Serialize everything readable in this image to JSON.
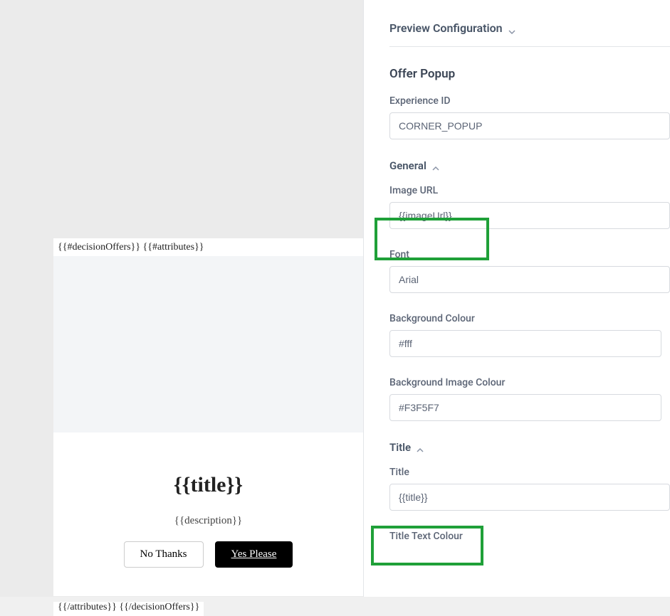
{
  "preview": {
    "header_template": "{{#decisionOffers}} {{#attributes}}",
    "footer_template": "{{/attributes}} {{/decisionOffers}}",
    "title_placeholder": "{{title}}",
    "description_placeholder": "{{description}}",
    "btn_no": "No Thanks",
    "btn_yes": "Yes Please"
  },
  "config": {
    "preview_config_label": "Preview Configuration",
    "offer_popup_title": "Offer Popup",
    "experience_id": {
      "label": "Experience ID",
      "value": "CORNER_POPUP"
    },
    "general": {
      "section_label": "General",
      "image_url": {
        "label": "Image URL",
        "value": "{{imageUrl}}"
      },
      "font": {
        "label": "Font",
        "value": "Arial"
      },
      "background_colour": {
        "label": "Background Colour",
        "value": "#fff"
      },
      "background_image_colour": {
        "label": "Background Image Colour",
        "value": "#F3F5F7"
      }
    },
    "title_section": {
      "section_label": "Title",
      "title": {
        "label": "Title",
        "value": "{{title}}"
      },
      "title_text_colour": {
        "label": "Title Text Colour"
      }
    }
  }
}
